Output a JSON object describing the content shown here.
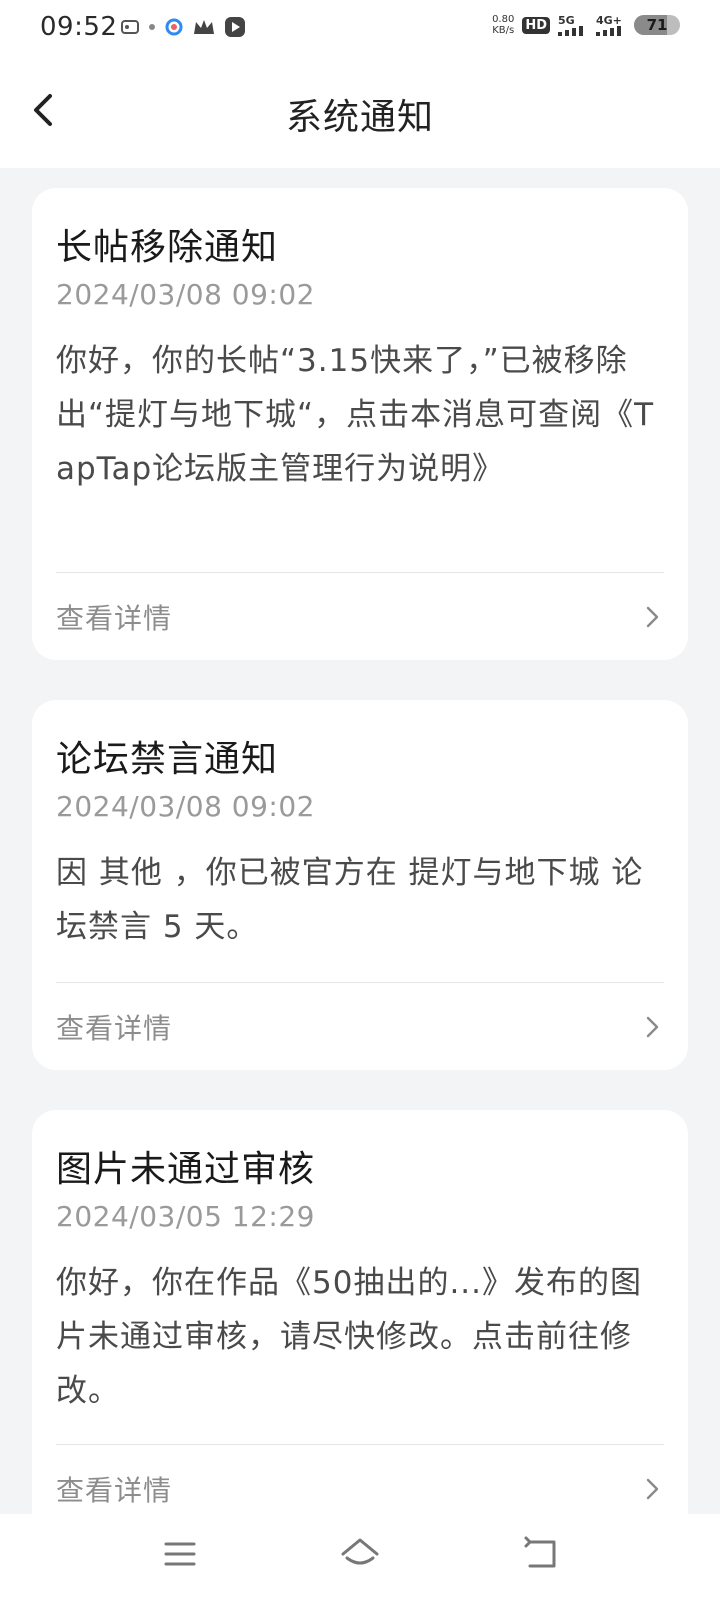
{
  "status_bar": {
    "time": "09:52",
    "net_speed_value": "0.80",
    "net_speed_unit": "KB/s",
    "hd_label": "HD",
    "sim1_label": "5G",
    "sim2_label": "4G+",
    "battery_level": "71",
    "battery_fraction": 0.71
  },
  "header": {
    "title": "系统通知"
  },
  "cards": [
    {
      "title": "长帖移除通知",
      "date": "2024/03/08 09:02",
      "body": "你好，你的长帖“3.15快来了，”已被移除出“提灯与地下城“，点击本消息可查阅《TapTap论坛版主管理行为说明》",
      "link_label": "查看详情"
    },
    {
      "title": "论坛禁言通知",
      "date": "2024/03/08 09:02",
      "body": "因 其他 ，你已被官方在 提灯与地下城 论坛禁言 5 天。",
      "link_label": "查看详情"
    },
    {
      "title": "图片未通过审核",
      "date": "2024/03/05 12:29",
      "body": "你好，你在作品《50抽出的...》发布的图片未通过审核，请尽快修改。点击前往修改。",
      "link_label": "查看详情"
    }
  ],
  "icons": {
    "back": "back-arrow-icon",
    "chevron": "chevron-right-icon",
    "menu": "menu-icon",
    "home": "home-icon",
    "return": "return-icon"
  }
}
